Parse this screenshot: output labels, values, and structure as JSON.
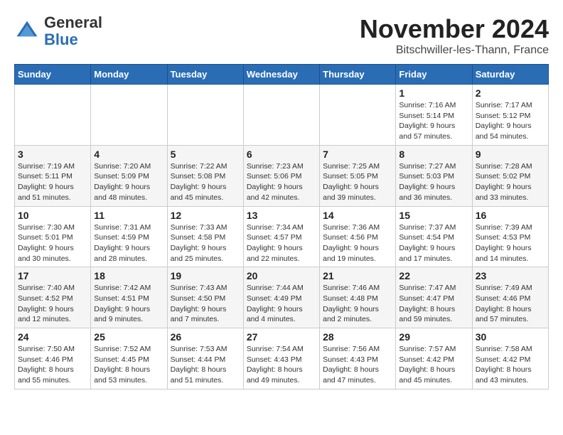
{
  "logo": {
    "general": "General",
    "blue": "Blue"
  },
  "header": {
    "month": "November 2024",
    "location": "Bitschwiller-les-Thann, France"
  },
  "days_of_week": [
    "Sunday",
    "Monday",
    "Tuesday",
    "Wednesday",
    "Thursday",
    "Friday",
    "Saturday"
  ],
  "weeks": [
    {
      "days": [
        {
          "date": "",
          "info": ""
        },
        {
          "date": "",
          "info": ""
        },
        {
          "date": "",
          "info": ""
        },
        {
          "date": "",
          "info": ""
        },
        {
          "date": "",
          "info": ""
        },
        {
          "date": "1",
          "info": "Sunrise: 7:16 AM\nSunset: 5:14 PM\nDaylight: 9 hours and 57 minutes."
        },
        {
          "date": "2",
          "info": "Sunrise: 7:17 AM\nSunset: 5:12 PM\nDaylight: 9 hours and 54 minutes."
        }
      ]
    },
    {
      "days": [
        {
          "date": "3",
          "info": "Sunrise: 7:19 AM\nSunset: 5:11 PM\nDaylight: 9 hours and 51 minutes."
        },
        {
          "date": "4",
          "info": "Sunrise: 7:20 AM\nSunset: 5:09 PM\nDaylight: 9 hours and 48 minutes."
        },
        {
          "date": "5",
          "info": "Sunrise: 7:22 AM\nSunset: 5:08 PM\nDaylight: 9 hours and 45 minutes."
        },
        {
          "date": "6",
          "info": "Sunrise: 7:23 AM\nSunset: 5:06 PM\nDaylight: 9 hours and 42 minutes."
        },
        {
          "date": "7",
          "info": "Sunrise: 7:25 AM\nSunset: 5:05 PM\nDaylight: 9 hours and 39 minutes."
        },
        {
          "date": "8",
          "info": "Sunrise: 7:27 AM\nSunset: 5:03 PM\nDaylight: 9 hours and 36 minutes."
        },
        {
          "date": "9",
          "info": "Sunrise: 7:28 AM\nSunset: 5:02 PM\nDaylight: 9 hours and 33 minutes."
        }
      ]
    },
    {
      "days": [
        {
          "date": "10",
          "info": "Sunrise: 7:30 AM\nSunset: 5:01 PM\nDaylight: 9 hours and 30 minutes."
        },
        {
          "date": "11",
          "info": "Sunrise: 7:31 AM\nSunset: 4:59 PM\nDaylight: 9 hours and 28 minutes."
        },
        {
          "date": "12",
          "info": "Sunrise: 7:33 AM\nSunset: 4:58 PM\nDaylight: 9 hours and 25 minutes."
        },
        {
          "date": "13",
          "info": "Sunrise: 7:34 AM\nSunset: 4:57 PM\nDaylight: 9 hours and 22 minutes."
        },
        {
          "date": "14",
          "info": "Sunrise: 7:36 AM\nSunset: 4:56 PM\nDaylight: 9 hours and 19 minutes."
        },
        {
          "date": "15",
          "info": "Sunrise: 7:37 AM\nSunset: 4:54 PM\nDaylight: 9 hours and 17 minutes."
        },
        {
          "date": "16",
          "info": "Sunrise: 7:39 AM\nSunset: 4:53 PM\nDaylight: 9 hours and 14 minutes."
        }
      ]
    },
    {
      "days": [
        {
          "date": "17",
          "info": "Sunrise: 7:40 AM\nSunset: 4:52 PM\nDaylight: 9 hours and 12 minutes."
        },
        {
          "date": "18",
          "info": "Sunrise: 7:42 AM\nSunset: 4:51 PM\nDaylight: 9 hours and 9 minutes."
        },
        {
          "date": "19",
          "info": "Sunrise: 7:43 AM\nSunset: 4:50 PM\nDaylight: 9 hours and 7 minutes."
        },
        {
          "date": "20",
          "info": "Sunrise: 7:44 AM\nSunset: 4:49 PM\nDaylight: 9 hours and 4 minutes."
        },
        {
          "date": "21",
          "info": "Sunrise: 7:46 AM\nSunset: 4:48 PM\nDaylight: 9 hours and 2 minutes."
        },
        {
          "date": "22",
          "info": "Sunrise: 7:47 AM\nSunset: 4:47 PM\nDaylight: 8 hours and 59 minutes."
        },
        {
          "date": "23",
          "info": "Sunrise: 7:49 AM\nSunset: 4:46 PM\nDaylight: 8 hours and 57 minutes."
        }
      ]
    },
    {
      "days": [
        {
          "date": "24",
          "info": "Sunrise: 7:50 AM\nSunset: 4:46 PM\nDaylight: 8 hours and 55 minutes."
        },
        {
          "date": "25",
          "info": "Sunrise: 7:52 AM\nSunset: 4:45 PM\nDaylight: 8 hours and 53 minutes."
        },
        {
          "date": "26",
          "info": "Sunrise: 7:53 AM\nSunset: 4:44 PM\nDaylight: 8 hours and 51 minutes."
        },
        {
          "date": "27",
          "info": "Sunrise: 7:54 AM\nSunset: 4:43 PM\nDaylight: 8 hours and 49 minutes."
        },
        {
          "date": "28",
          "info": "Sunrise: 7:56 AM\nSunset: 4:43 PM\nDaylight: 8 hours and 47 minutes."
        },
        {
          "date": "29",
          "info": "Sunrise: 7:57 AM\nSunset: 4:42 PM\nDaylight: 8 hours and 45 minutes."
        },
        {
          "date": "30",
          "info": "Sunrise: 7:58 AM\nSunset: 4:42 PM\nDaylight: 8 hours and 43 minutes."
        }
      ]
    }
  ]
}
